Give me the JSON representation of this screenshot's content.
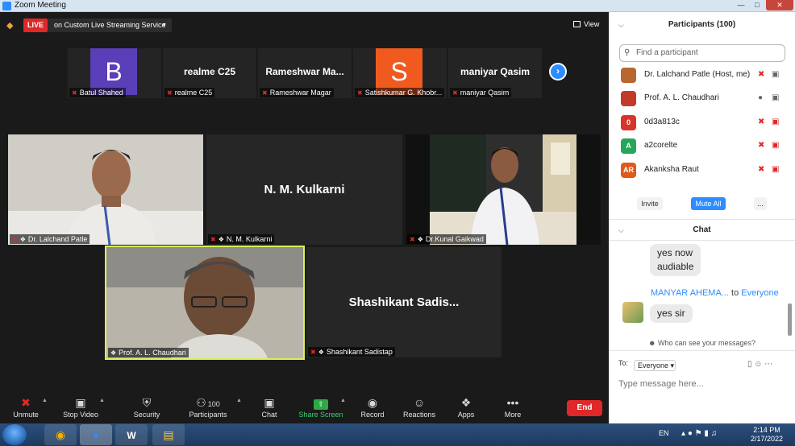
{
  "window": {
    "title": "Zoom Meeting"
  },
  "topbar": {
    "live": "LIVE",
    "service": "on Custom Live Streaming Service",
    "view": "View"
  },
  "filmstrip": [
    {
      "letter": "B",
      "color": "#5b3fb8",
      "label": "Batul Shahed"
    },
    {
      "bigname": "realme C25",
      "label": "realme C25"
    },
    {
      "bigname": "Rameshwar  Ma...",
      "label": "Rameshwar Magar"
    },
    {
      "letter": "S",
      "color": "#f05a1e",
      "label": "Satishkumar G. Khobr..."
    },
    {
      "bigname": "maniyar Qasim",
      "label": "maniyar Qasim"
    }
  ],
  "tiles": [
    {
      "label": "Dr. Lalchand Patle"
    },
    {
      "bigname": "N. M. Kulkarni",
      "label": "N. M. Kulkarni"
    },
    {
      "label": "Dr.Kunal Gaikwad"
    },
    {
      "label": "Prof. A. L. Chaudhari"
    },
    {
      "bigname": "Shashikant  Sadis...",
      "label": "Shashikant Sadistap"
    }
  ],
  "toolbar": {
    "unmute": "Unmute",
    "stop_video": "Stop Video",
    "security": "Security",
    "participants": "Participants",
    "participants_count": "100",
    "chat": "Chat",
    "share": "Share Screen",
    "record": "Record",
    "reactions": "Reactions",
    "apps": "Apps",
    "more": "More",
    "end": "End"
  },
  "panel": {
    "participants_title": "Participants (100)",
    "search_placeholder": "Find a participant",
    "participants": [
      {
        "initials": "",
        "color": "#b8672e",
        "name": "Dr. Lalchand Patle (Host, me)"
      },
      {
        "initials": "",
        "color": "#c43a2a",
        "name": "Prof. A. L. Chaudhari"
      },
      {
        "initials": "0",
        "color": "#d9342b",
        "name": "0d3a813c"
      },
      {
        "initials": "A",
        "color": "#26a65b",
        "name": "a2corelte"
      },
      {
        "initials": "AR",
        "color": "#e05a1e",
        "name": "Akanksha Raut"
      }
    ],
    "invite": "Invite",
    "mute_all": "Mute All",
    "more": "...",
    "chat_title": "Chat",
    "messages": [
      {
        "text1": "yes now",
        "text2": "audiable"
      },
      {
        "sender": "MANYAR AHEMA...",
        "to_word": "to",
        "to": "Everyone",
        "text": "yes sir"
      }
    ],
    "who_can_see": "Who can see your messages?",
    "to_label": "To:",
    "to_value": "Everyone",
    "chat_placeholder": "Type message here..."
  },
  "taskbar": {
    "lang": "EN",
    "time": "2:14 PM",
    "date": "2/17/2022"
  }
}
